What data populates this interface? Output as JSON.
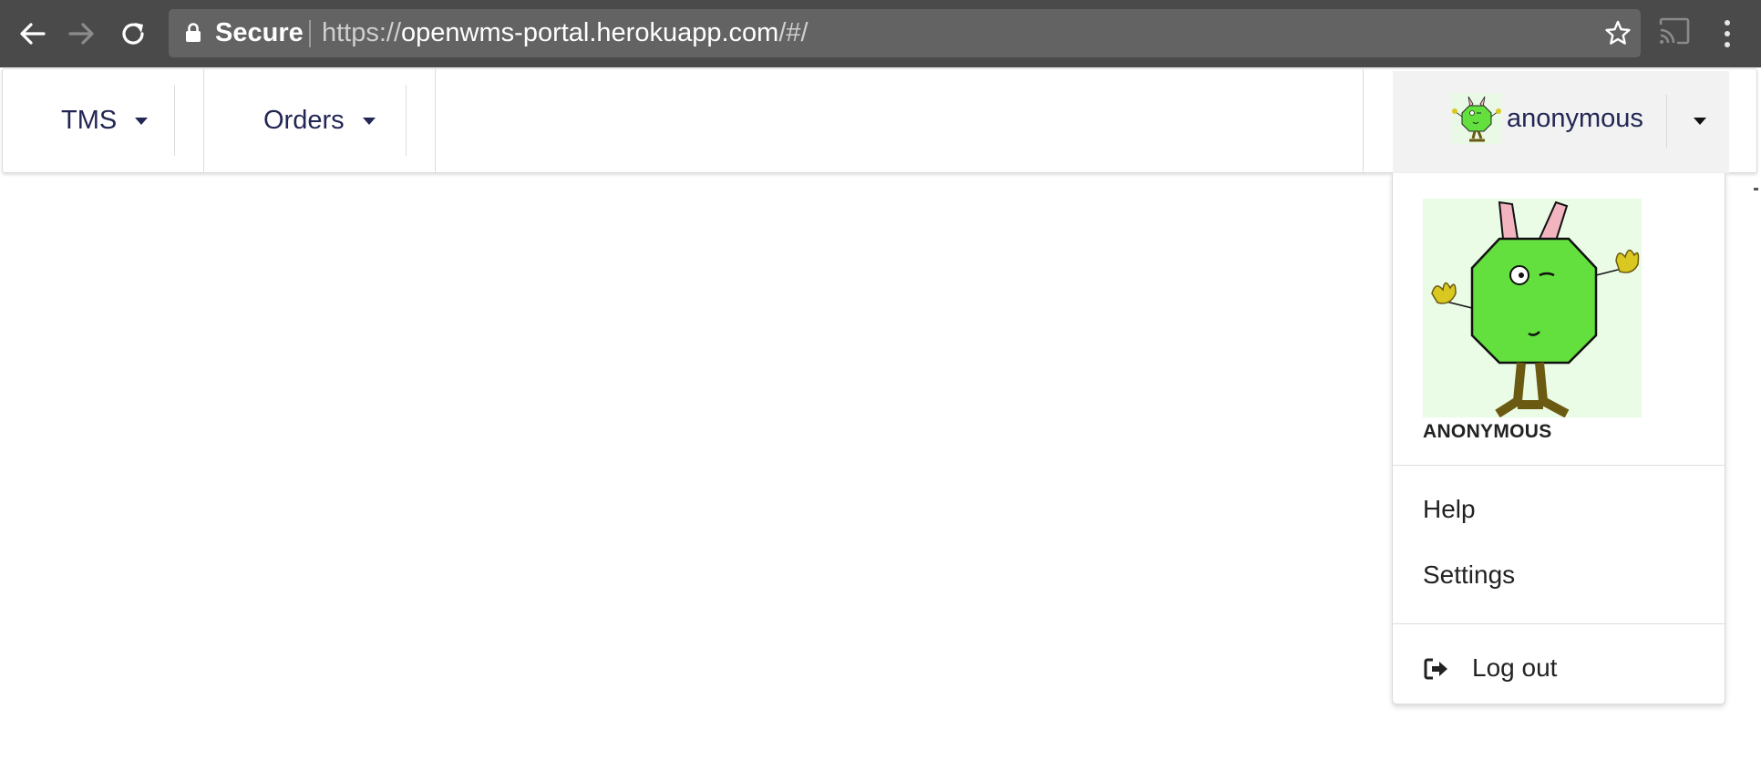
{
  "browser": {
    "secure_label": "Secure",
    "url_scheme": "https://",
    "url_host": "openwms-portal.herokuapp.com",
    "url_path": "/#/",
    "icons": [
      "back-arrow-icon",
      "forward-arrow-icon",
      "reload-icon",
      "lock-icon",
      "star-icon",
      "cast-icon",
      "more-vert-icon"
    ]
  },
  "navbar": {
    "items": [
      {
        "label": "TMS"
      },
      {
        "label": "Orders"
      }
    ],
    "user": {
      "name": "anonymous"
    },
    "colors": {
      "nav_text": "#232755",
      "user_bg": "#f2f2f2"
    }
  },
  "dropdown": {
    "display_name": "ANONYMOUS",
    "items": [
      {
        "label": "Help"
      },
      {
        "label": "Settings"
      }
    ],
    "logout_label": "Log out"
  }
}
